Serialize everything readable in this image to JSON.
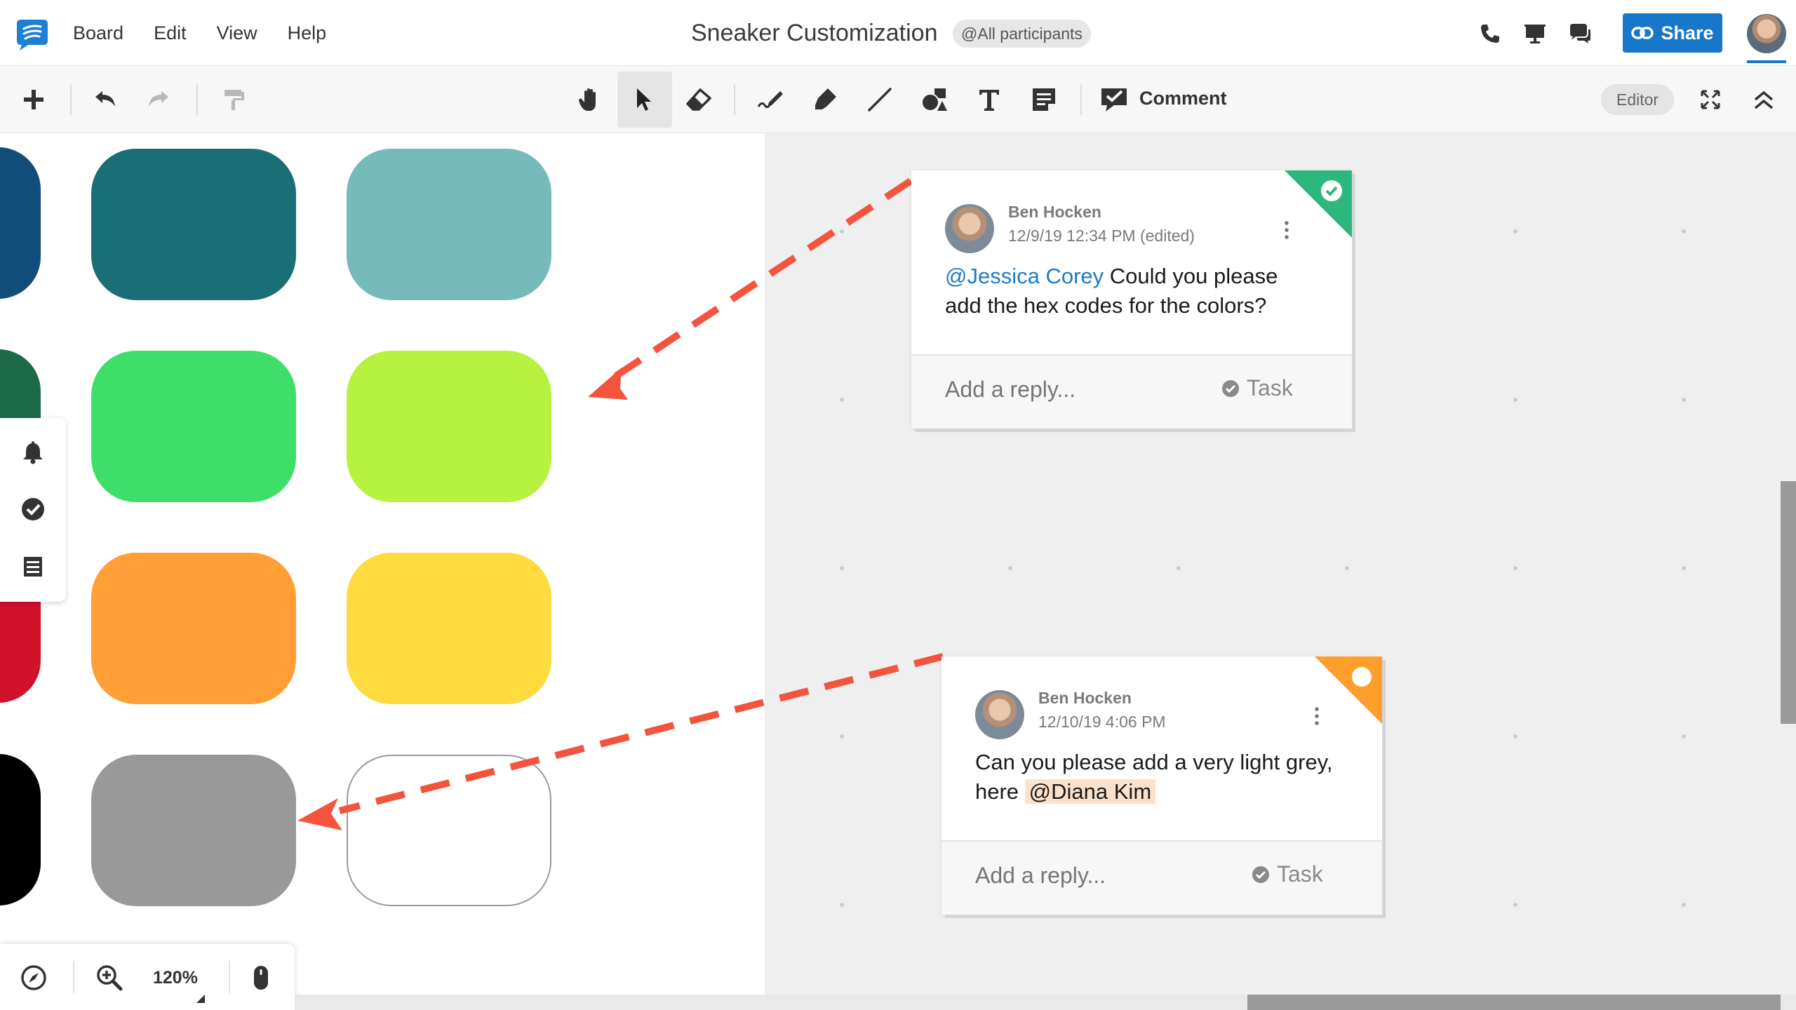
{
  "app": {
    "menu": [
      "Board",
      "Edit",
      "View",
      "Help"
    ],
    "title": "Sneaker Customization",
    "participants_badge": "@All participants",
    "share_label": "Share",
    "top_icons": [
      "phone-icon",
      "present-icon",
      "chat-icon"
    ]
  },
  "toolbar": {
    "left_icons": [
      "add-icon",
      "undo-icon",
      "redo-icon",
      "format-painter-icon"
    ],
    "tools": [
      "hand-icon",
      "pointer-icon",
      "eraser-icon",
      "pen-icon",
      "highlighter-icon",
      "line-icon",
      "shapes-icon",
      "text-icon",
      "sticky-note-icon"
    ],
    "active_tool": "pointer-icon",
    "comment_label": "Comment",
    "mode_badge": "Editor",
    "right_icons": [
      "fullscreen-icon",
      "collapse-icon"
    ]
  },
  "canvas": {
    "swatch_colors": {
      "row1": [
        "#1a6e75",
        "#77baba"
      ],
      "row2": [
        "#3ddf69",
        "#b8f240"
      ],
      "row3": [
        "#ff9f35",
        "#ffdb3f"
      ],
      "row4": [
        "#999999",
        "#ffffff"
      ],
      "partial_column": [
        "#124d7a",
        "#1d6a4a",
        "#d0122b",
        "#000000"
      ]
    },
    "arrow_color": "#f4533d"
  },
  "left_panel": {
    "icons": [
      "bell-icon",
      "task-check-icon",
      "list-icon"
    ]
  },
  "zoom_panel": {
    "zoom_level": "120%",
    "icons": [
      "navigator-icon",
      "zoom-in-icon",
      "mouse-icon"
    ]
  },
  "comments": [
    {
      "author": "Ben Hocken",
      "timestamp": "12/9/19 12:34 PM (edited)",
      "mention": "@Jessica Corey",
      "text": " Could you please add the hex codes for the colors?",
      "reply_placeholder": "Add a reply...",
      "task_label": "Task",
      "status": "resolved",
      "status_color": "#2db77e"
    },
    {
      "author": "Ben Hocken",
      "timestamp": "12/10/19 4:06 PM",
      "text": "Can you please add a very light grey, here ",
      "mention": "@Diana Kim",
      "reply_placeholder": "Add a reply...",
      "task_label": "Task",
      "status": "open",
      "status_color": "#ff9e2c"
    }
  ]
}
